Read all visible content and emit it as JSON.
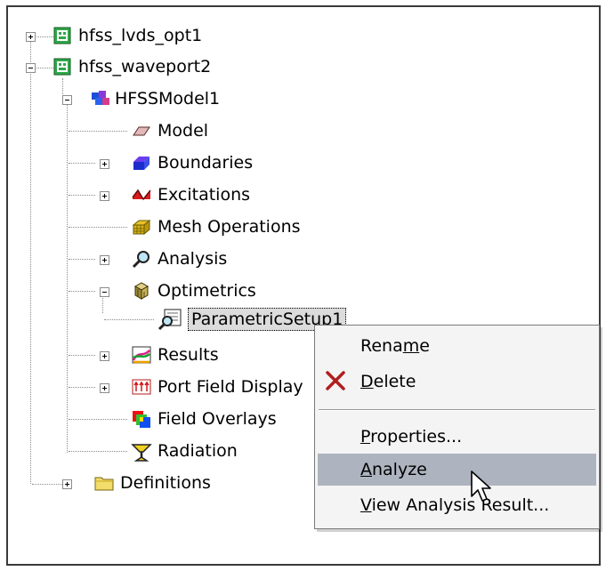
{
  "tree": {
    "projects": [
      {
        "label": "hfss_lvds_opt1",
        "expanded": false
      },
      {
        "label": "hfss_waveport2",
        "expanded": true
      }
    ],
    "design": "HFSSModel1",
    "items": {
      "model": "Model",
      "boundaries": "Boundaries",
      "excitations": "Excitations",
      "mesh": "Mesh Operations",
      "analysis": "Analysis",
      "optimetrics": "Optimetrics",
      "parametric": "ParametricSetup1",
      "results": "Results",
      "portfield": "Port Field Display",
      "overlays": "Field Overlays",
      "radiation": "Radiation"
    },
    "definitions": "Definitions"
  },
  "context_menu": {
    "rename": {
      "pre": "Rena",
      "u": "m",
      "post": "e"
    },
    "delete": {
      "pre": "",
      "u": "D",
      "post": "elete"
    },
    "properties": {
      "pre": "",
      "u": "P",
      "post": "roperties..."
    },
    "analyze": {
      "pre": "",
      "u": "A",
      "post": "nalyze"
    },
    "view": {
      "pre": "",
      "u": "V",
      "post": "iew Analysis Result..."
    },
    "hovered": "Analyze"
  },
  "colors": {
    "menu_hover": "#aeb4bf",
    "selection": "#dcdcdc",
    "delete_icon": "#b01e1e"
  }
}
